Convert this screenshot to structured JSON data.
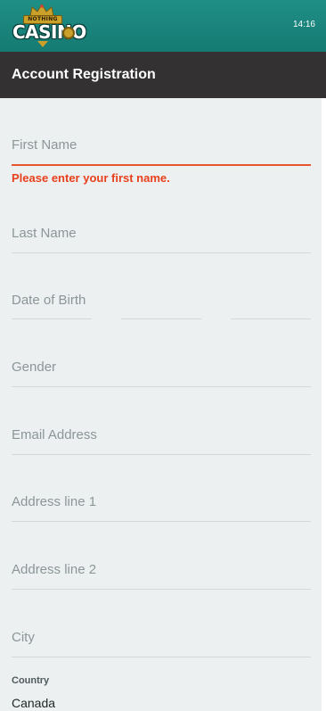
{
  "status_bar": {
    "time": "14:16"
  },
  "brand": {
    "banner": "NOTHING",
    "word": "CASINO"
  },
  "header": {
    "title": "Account Registration"
  },
  "form": {
    "first_name": {
      "placeholder": "First Name",
      "error": "Please enter your first name."
    },
    "last_name": {
      "placeholder": "Last Name"
    },
    "dob": {
      "placeholder": "Date of Birth"
    },
    "gender": {
      "placeholder": "Gender"
    },
    "email": {
      "placeholder": "Email Address"
    },
    "address1": {
      "placeholder": "Address line 1"
    },
    "address2": {
      "placeholder": "Address line 2"
    },
    "city": {
      "placeholder": "City"
    },
    "country": {
      "label": "Country",
      "value": "Canada"
    }
  },
  "colors": {
    "topbar": "#1f8f86",
    "titlebar": "#333131",
    "background": "#ecf0f0",
    "error": "#e8401d"
  }
}
